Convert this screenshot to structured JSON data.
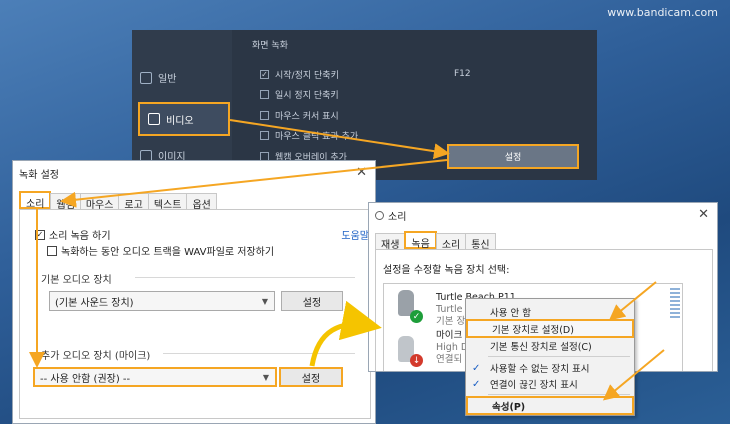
{
  "watermark": "www.bandicam.com",
  "bandicam": {
    "nav": [
      {
        "label": "일반",
        "icon": "gear-icon"
      },
      {
        "label": "비디오",
        "icon": "video-settings-icon"
      },
      {
        "label": "이미지",
        "icon": "image-icon"
      }
    ],
    "section_title": "화면 녹화",
    "options": [
      {
        "label": "시작/정지 단축키",
        "checked": true,
        "key": "F12"
      },
      {
        "label": "일시 정지 단축키",
        "checked": false,
        "key": ""
      },
      {
        "label": "마우스 커서 표시",
        "checked": false,
        "key": ""
      },
      {
        "label": "마우스 클릭 효과 추가",
        "checked": false,
        "key": ""
      },
      {
        "label": "웹캠 오버레이 추가",
        "checked": false,
        "key": ""
      }
    ],
    "settings_button": "설정"
  },
  "rec_window": {
    "title": "녹화 설정",
    "tabs": [
      "소리",
      "웹캠",
      "마우스",
      "로고",
      "텍스트",
      "옵션"
    ],
    "record_audio": "소리 녹음 하기",
    "save_wav": "녹화하는 동안 오디오 트랙을 WAV파일로 저장하기",
    "help": "도움말",
    "primary_label": "기본 오디오 장치",
    "primary_value": "(기본 사운드 장치)",
    "secondary_label": "추가 오디오 장치 (마이크)",
    "secondary_value": "-- 사용 안함 (권장) --",
    "settings": "설정"
  },
  "sound_window": {
    "title": "소리",
    "tabs": [
      "재생",
      "녹음",
      "소리",
      "통신"
    ],
    "instruction": "설정을 수정할 녹음 장치 선택:",
    "devices": [
      {
        "name": "Turtle Beach P11",
        "line2": "Turtle B",
        "line3": "기본 장"
      },
      {
        "name": "마이크",
        "line2": "High D",
        "line3": "연결되"
      }
    ]
  },
  "context_menu": {
    "items": [
      "사용 안 함",
      "기본 장치로 설정(D)",
      "기본 통신 장치로 설정(C)",
      "사용할 수 없는 장치 표시",
      "연결이 끊긴 장치 표시",
      "속성(P)"
    ]
  },
  "colors": {
    "highlight": "#f5a623",
    "link": "#1a5fc4",
    "badge_green": "#1e9e3a",
    "badge_red": "#d33a2c"
  }
}
